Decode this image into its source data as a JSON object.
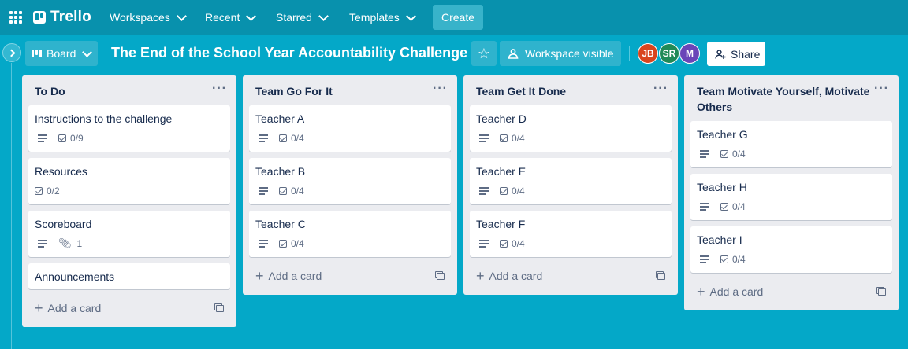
{
  "nav": {
    "logo": "Trello",
    "workspaces": "Workspaces",
    "recent": "Recent",
    "starred": "Starred",
    "templates": "Templates",
    "create": "Create"
  },
  "board": {
    "view_label": "Board",
    "title": "The End of the School Year Accountability Challenge",
    "visibility": "Workspace visible",
    "share": "Share",
    "members": [
      {
        "initials": "JB",
        "color": "#d9451e"
      },
      {
        "initials": "SR",
        "color": "#1f8a57"
      },
      {
        "initials": "M",
        "color": "#6a45b8"
      }
    ]
  },
  "lists": [
    {
      "title": "To Do",
      "add_card": "Add a card",
      "cards": [
        {
          "title": "Instructions to the challenge",
          "description": true,
          "checklist": "0/9"
        },
        {
          "title": "Resources",
          "description": false,
          "checklist": "0/2"
        },
        {
          "title": "Scoreboard",
          "description": true,
          "attachments": "1"
        },
        {
          "title": "Announcements",
          "description": false
        }
      ]
    },
    {
      "title": "Team Go For It",
      "add_card": "Add a card",
      "cards": [
        {
          "title": "Teacher A",
          "description": true,
          "checklist": "0/4"
        },
        {
          "title": "Teacher B",
          "description": true,
          "checklist": "0/4"
        },
        {
          "title": "Teacher C",
          "description": true,
          "checklist": "0/4"
        }
      ]
    },
    {
      "title": "Team Get It Done",
      "add_card": "Add a card",
      "cards": [
        {
          "title": "Teacher D",
          "description": true,
          "checklist": "0/4"
        },
        {
          "title": "Teacher E",
          "description": true,
          "checklist": "0/4"
        },
        {
          "title": "Teacher F",
          "description": true,
          "checklist": "0/4"
        }
      ]
    },
    {
      "title": "Team Motivate Yourself, Motivate Others",
      "add_card": "Add a card",
      "cards": [
        {
          "title": "Teacher G",
          "description": true,
          "checklist": "0/4"
        },
        {
          "title": "Teacher H",
          "description": true,
          "checklist": "0/4"
        },
        {
          "title": "Teacher I",
          "description": true,
          "checklist": "0/4"
        }
      ]
    }
  ]
}
